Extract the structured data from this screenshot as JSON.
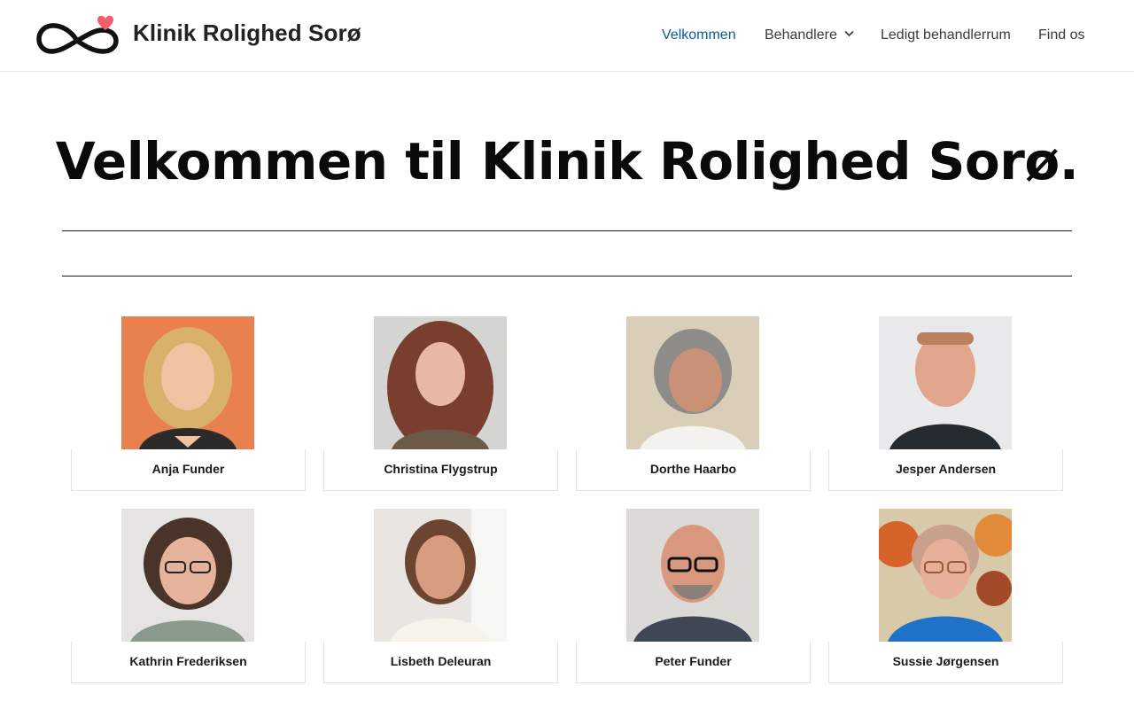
{
  "header": {
    "site_title": "Klinik Rolighed Sorø",
    "logo_icon": "infinity-heart-logo",
    "nav": [
      {
        "label": "Velkommen",
        "active": true
      },
      {
        "label": "Behandlere",
        "has_dropdown": true
      },
      {
        "label": "Ledigt behandlerrum"
      },
      {
        "label": "Find os"
      }
    ]
  },
  "main": {
    "title": "Velkommen til Klinik Rolighed Sorø."
  },
  "therapists": [
    {
      "name": "Anja Funder"
    },
    {
      "name": "Christina Flygstrup"
    },
    {
      "name": "Dorthe Haarbo"
    },
    {
      "name": "Jesper Andersen"
    },
    {
      "name": "Kathrin Frederiksen"
    },
    {
      "name": "Lisbeth Deleuran"
    },
    {
      "name": "Peter Funder"
    },
    {
      "name": "Sussie Jørgensen"
    }
  ],
  "colors": {
    "accent": "#0b5a9c",
    "logo_heart": "#f25f6b",
    "text": "#1f1f1f"
  }
}
